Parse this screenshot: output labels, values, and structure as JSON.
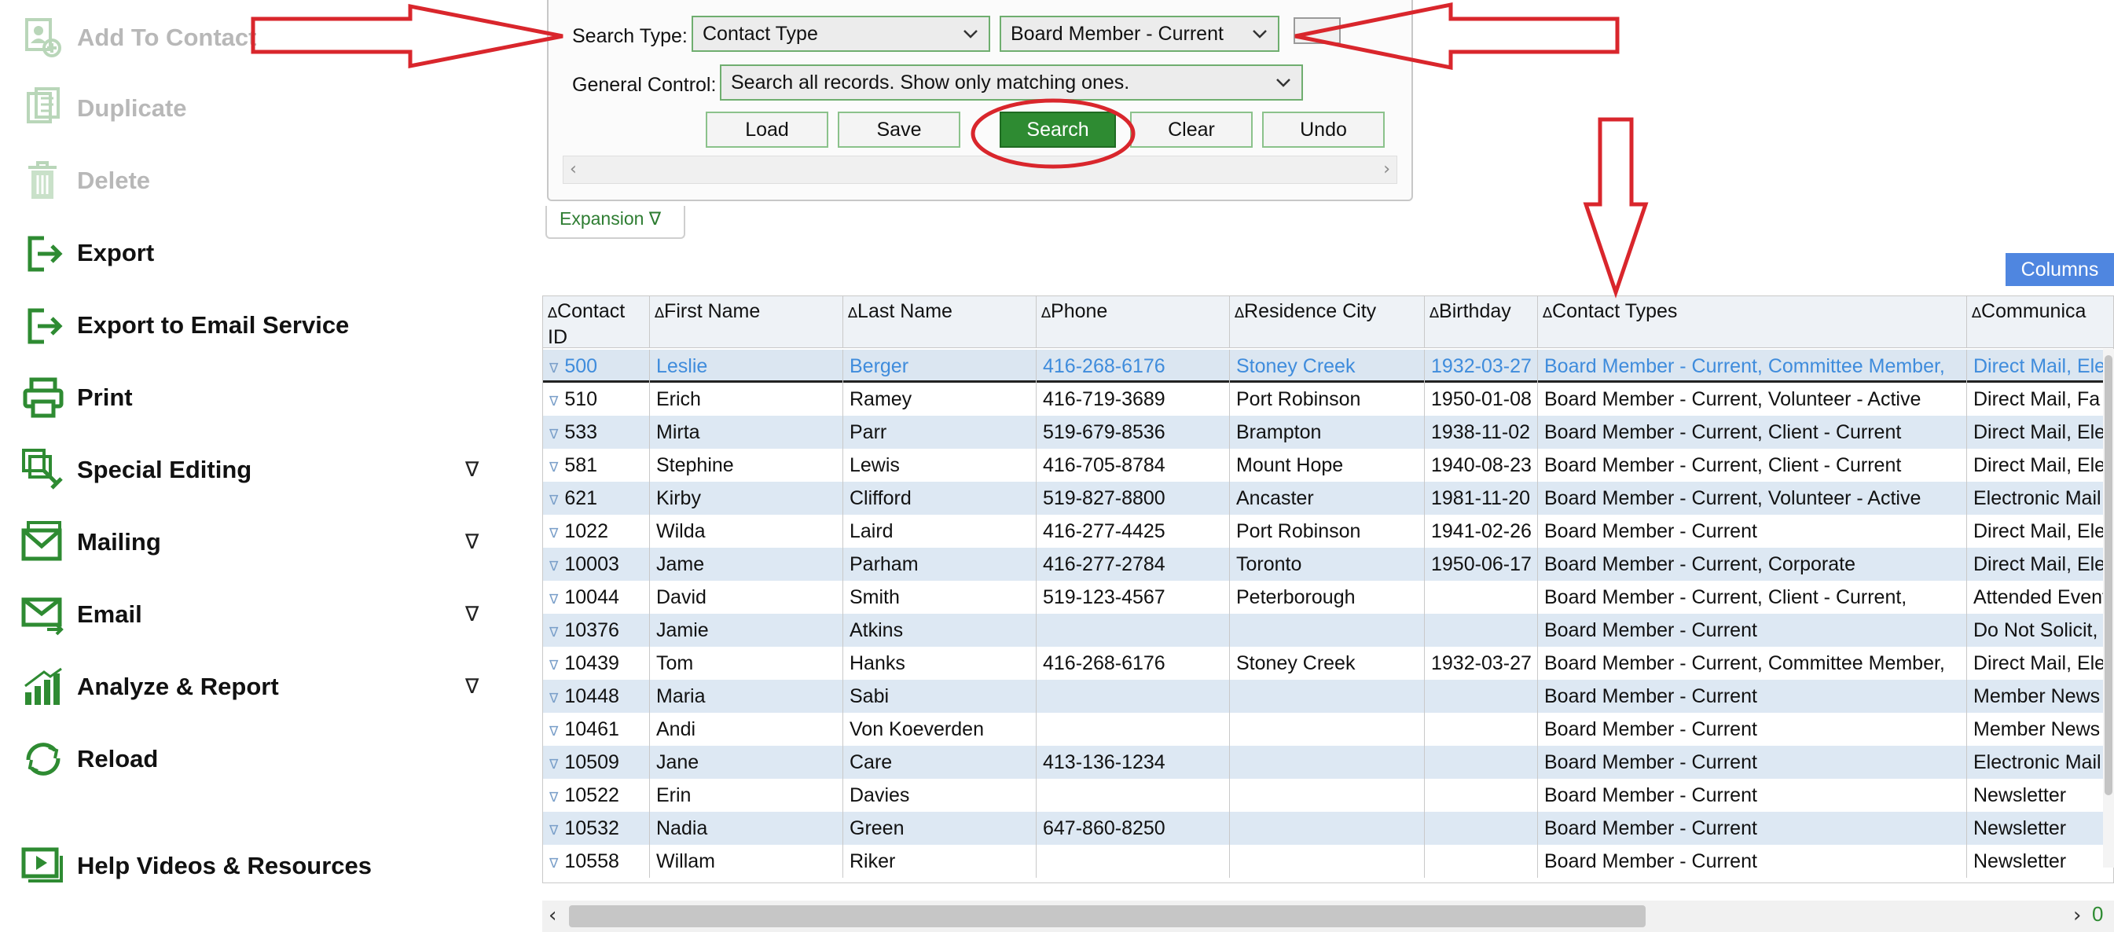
{
  "sidebar": {
    "items": [
      {
        "label": "Add To Contact",
        "icon": "add-contact-icon",
        "disabled": true
      },
      {
        "label": "Duplicate",
        "icon": "duplicate-icon",
        "disabled": true
      },
      {
        "label": "Delete",
        "icon": "trash-icon",
        "disabled": true
      },
      {
        "label": "Export",
        "icon": "export-icon",
        "disabled": false
      },
      {
        "label": "Export to Email Service",
        "icon": "export-icon",
        "disabled": false
      },
      {
        "label": "Print",
        "icon": "printer-icon",
        "disabled": false
      },
      {
        "label": "Special Editing",
        "icon": "special-editing-icon",
        "disabled": false,
        "expand": "∇"
      },
      {
        "label": "Mailing",
        "icon": "mail-icon",
        "disabled": false,
        "expand": "∇"
      },
      {
        "label": "Email",
        "icon": "email-icon",
        "disabled": false,
        "expand": "∇"
      },
      {
        "label": "Analyze & Report",
        "icon": "bar-chart-icon",
        "disabled": false,
        "expand": "∇"
      },
      {
        "label": "Reload",
        "icon": "reload-icon",
        "disabled": false
      },
      {
        "label": "Help Videos & Resources",
        "icon": "video-icon",
        "disabled": false
      }
    ]
  },
  "search": {
    "type_label": "Search Type:",
    "type_value": "Contact Type",
    "criteria_value": "Board Member - Current",
    "general_label": "General Control:",
    "general_value": "Search all records. Show only matching ones.",
    "buttons": {
      "load": "Load",
      "save": "Save",
      "search": "Search",
      "clear": "Clear",
      "undo": "Undo"
    }
  },
  "expansion_label": "Expansion ∇",
  "columns_button": "Columns",
  "grid": {
    "headers": [
      "Contact ID",
      "First Name",
      "Last Name",
      "Phone",
      "Residence City",
      "Birthday",
      "Contact Types",
      "Communica"
    ],
    "rows": [
      [
        "500",
        "Leslie",
        "Berger",
        "416-268-6176",
        "Stoney Creek",
        "1932-03-27",
        "Board Member - Current, Committee Member,",
        "Direct Mail, Ele"
      ],
      [
        "510",
        "Erich",
        "Ramey",
        "416-719-3689",
        "Port Robinson",
        "1950-01-08",
        "Board Member - Current, Volunteer - Active",
        "Direct Mail, Fa"
      ],
      [
        "533",
        "Mirta",
        "Parr",
        "519-679-8536",
        "Brampton",
        "1938-11-02",
        "Board Member - Current, Client - Current",
        "Direct Mail, Ele"
      ],
      [
        "581",
        "Stephine",
        "Lewis",
        "416-705-8784",
        "Mount Hope",
        "1940-08-23",
        "Board Member - Current, Client - Current",
        "Direct Mail, Ele"
      ],
      [
        "621",
        "Kirby",
        "Clifford",
        "519-827-8800",
        "Ancaster",
        "1981-11-20",
        "Board Member - Current, Volunteer - Active",
        "Electronic Mail"
      ],
      [
        "1022",
        "Wilda",
        "Laird",
        "416-277-4425",
        "Port Robinson",
        "1941-02-26",
        "Board Member - Current",
        "Direct Mail, Ele"
      ],
      [
        "10003",
        "Jame",
        "Parham",
        "416-277-2784",
        "Toronto",
        "1950-06-17",
        "Board Member - Current, Corporate",
        "Direct Mail, Ele"
      ],
      [
        "10044",
        "David",
        "Smith",
        "519-123-4567",
        "Peterborough",
        "",
        "Board Member - Current, Client - Current,",
        "Attended Event"
      ],
      [
        "10376",
        "Jamie",
        "Atkins",
        "",
        "",
        "",
        "Board Member - Current",
        "Do Not Solicit,"
      ],
      [
        "10439",
        "Tom",
        "Hanks",
        "416-268-6176",
        "Stoney Creek",
        "1932-03-27",
        "Board Member - Current, Committee Member,",
        "Direct Mail, Ele"
      ],
      [
        "10448",
        "Maria",
        "Sabi",
        "",
        "",
        "",
        "Board Member - Current",
        "Member News"
      ],
      [
        "10461",
        "Andi",
        "Von Koeverden",
        "",
        "",
        "",
        "Board Member - Current",
        "Member News"
      ],
      [
        "10509",
        "Jane",
        "Care",
        "413-136-1234",
        "",
        "",
        "Board Member - Current",
        "Electronic Mail"
      ],
      [
        "10522",
        "Erin",
        "Davies",
        "",
        "",
        "",
        "Board Member - Current",
        "Newsletter"
      ],
      [
        "10532",
        "Nadia",
        "Green",
        "647-860-8250",
        "",
        "",
        "Board Member - Current",
        "Newsletter"
      ],
      [
        "10558",
        "Willam",
        "Riker",
        "",
        "",
        "",
        "Board Member - Current",
        "Newsletter"
      ]
    ]
  },
  "footer_count": "0",
  "colors": {
    "accent_green": "#2e8b32",
    "link_blue": "#3f8cdc",
    "alt_row": "#dde8f3",
    "annotation_red": "#d9262c",
    "columns_blue": "#4f86e0"
  }
}
